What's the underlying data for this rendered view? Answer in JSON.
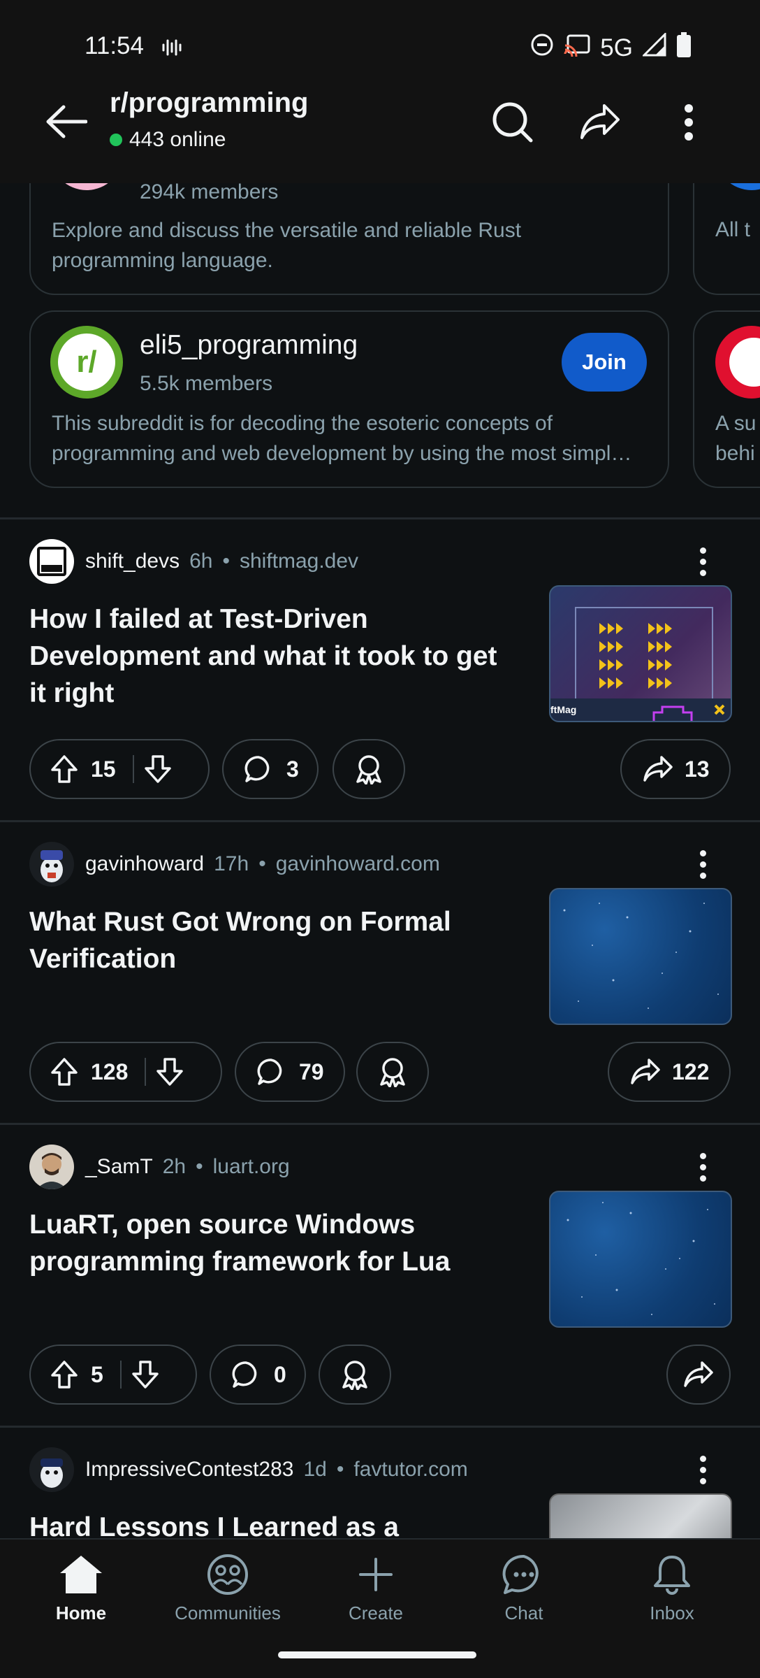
{
  "status": {
    "time": "11:54",
    "network": "5G"
  },
  "header": {
    "title": "r/programming",
    "online": "443 online"
  },
  "communities": [
    {
      "name": "",
      "members": "294k members",
      "desc": "Explore and discuss the versatile and reliable Rust programming language.",
      "avatar_color": "#f6b7d3"
    },
    {
      "name": "eli5_programming",
      "members": "5.5k members",
      "desc": "This subreddit is for decoding the esoteric concepts of programming and web development by using the most simpl…",
      "join": "Join",
      "avatar_color": "#5da829"
    }
  ],
  "side_cards": {
    "first_peek": "All t",
    "second_peek_line1": "A su",
    "second_peek_line2": "behi"
  },
  "posts": [
    {
      "author": "shift_devs",
      "time": "6h",
      "domain": "shiftmag.dev",
      "title": "How I failed at Test-Driven Development and what it took to get it right",
      "upvotes": "15",
      "comments": "3",
      "shares": "13",
      "thumb_label": "ftMag"
    },
    {
      "author": "gavinhoward",
      "time": "17h",
      "domain": "gavinhoward.com",
      "title": "What Rust Got Wrong on Formal Verification",
      "upvotes": "128",
      "comments": "79",
      "shares": "122"
    },
    {
      "author": "_SamT",
      "time": "2h",
      "domain": "luart.org",
      "title": "LuaRT, open source Windows programming framework for Lua",
      "upvotes": "5",
      "comments": "0",
      "shares": ""
    },
    {
      "author": "ImpressiveContest283",
      "time": "1d",
      "domain": "favtutor.com",
      "title": "Hard Lessons I Learned as a"
    }
  ],
  "separator": "•",
  "nav": {
    "home": "Home",
    "communities": "Communities",
    "create": "Create",
    "chat": "Chat",
    "inbox": "Inbox"
  },
  "colors": {
    "accent_blue": "#115bca",
    "online_green": "#21c45a",
    "background": "#0e1113"
  }
}
